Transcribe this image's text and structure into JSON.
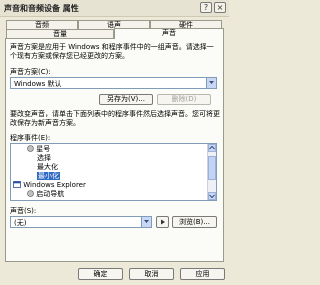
{
  "window": {
    "title": "声音和音频设备 属性",
    "help_glyph": "?",
    "close_glyph": "×"
  },
  "tabs_row1": [
    {
      "label": "音频"
    },
    {
      "label": "语声"
    },
    {
      "label": "硬件"
    }
  ],
  "tabs_row2": [
    {
      "label": "音量"
    },
    {
      "label": "声音",
      "active": true
    }
  ],
  "description": "声音方案是应用于 Windows 和程序事件中的一组声音。请选择一个现有方案或保存您已经更改的方案。",
  "scheme": {
    "label": "声音方案(C):",
    "value": "Windows 默认",
    "save_as_label": "另存为(V)...",
    "delete_label": "删除(D)"
  },
  "instructions": "要改变声音，请单击下面列表中的程序事件然后选择声音。您可将更改保存为新声音方案。",
  "events": {
    "label": "程序事件(E):",
    "items": [
      {
        "text": "星号",
        "icon": true
      },
      {
        "text": "选择",
        "icon": false
      },
      {
        "text": "最大化",
        "icon": false
      },
      {
        "text": "最小化",
        "icon": false,
        "selected": true
      },
      {
        "text": "Windows Explorer",
        "icon": true,
        "group": true
      },
      {
        "text": "启动导航",
        "icon": true
      }
    ]
  },
  "sound": {
    "label": "声音(S):",
    "value": "(无)",
    "browse_label": "浏览(B)..."
  },
  "footer": {
    "ok_label": "确定",
    "cancel_label": "取消",
    "apply_label": "应用"
  },
  "colors": {
    "selection": "#316ac5",
    "face": "#ece9d8",
    "field_border": "#7f9db9"
  }
}
